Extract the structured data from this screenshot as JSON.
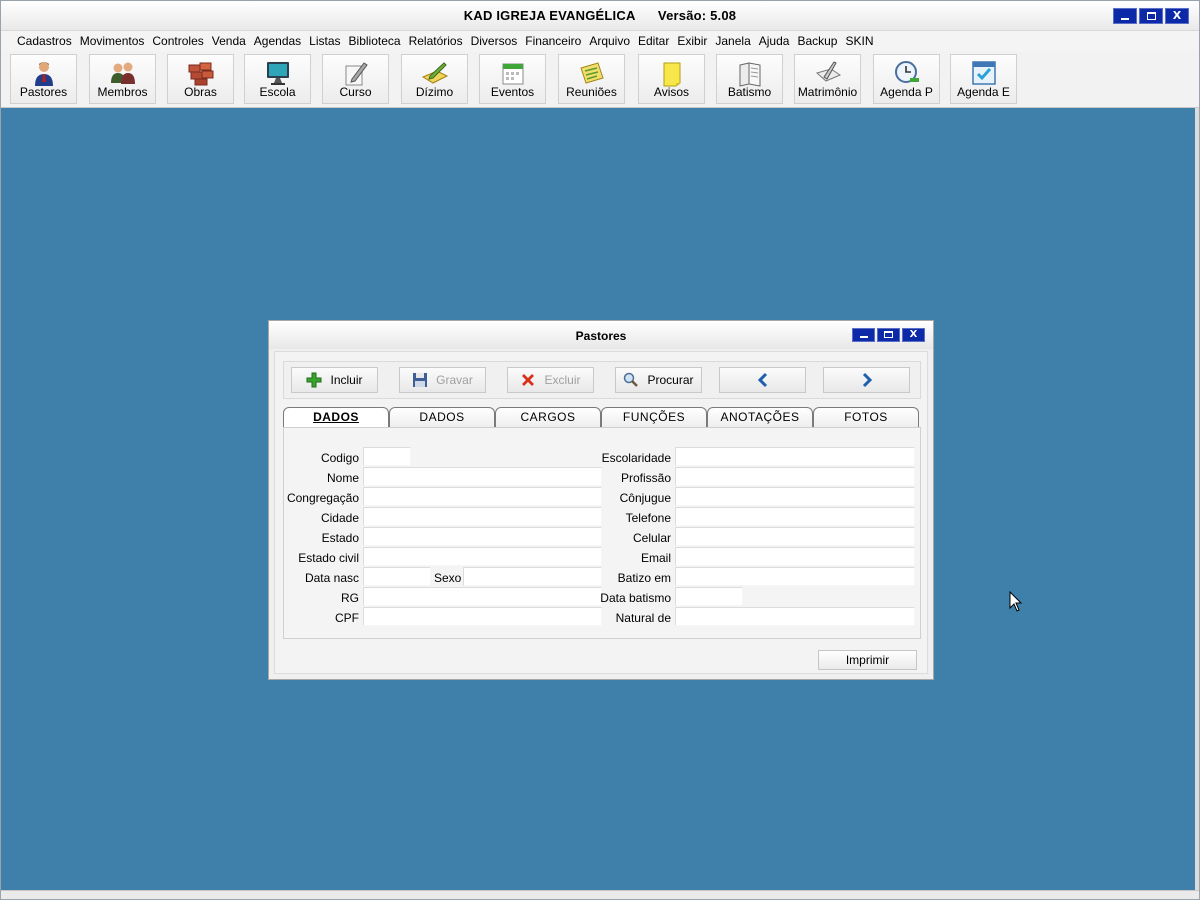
{
  "app": {
    "title": "KAD IGREJA EVANGÉLICA      Versão: 5.08",
    "window_buttons": {
      "close": "X"
    }
  },
  "menu": [
    "Cadastros",
    "Movimentos",
    "Controles",
    "Venda",
    "Agendas",
    "Listas",
    "Biblioteca",
    "Relatórios",
    "Diversos",
    "Financeiro",
    "Arquivo",
    "Editar",
    "Exibir",
    "Janela",
    "Ajuda",
    "Backup",
    "SKIN"
  ],
  "toolbar": [
    {
      "label": "Pastores",
      "icon": "pastor-icon"
    },
    {
      "label": "Membros",
      "icon": "members-icon"
    },
    {
      "label": "Obras",
      "icon": "bricks-icon"
    },
    {
      "label": "Escola",
      "icon": "monitor-icon"
    },
    {
      "label": "Curso",
      "icon": "pencil-paper-icon"
    },
    {
      "label": "Dízimo",
      "icon": "pen-note-icon"
    },
    {
      "label": "Eventos",
      "icon": "calendar-icon"
    },
    {
      "label": "Reuniões",
      "icon": "notes-icon"
    },
    {
      "label": "Avisos",
      "icon": "sticky-note-icon"
    },
    {
      "label": "Batismo",
      "icon": "book-icon"
    },
    {
      "label": "Matrimônio",
      "icon": "quill-book-icon"
    },
    {
      "label": "Agenda P",
      "icon": "clock-icon"
    },
    {
      "label": "Agenda E",
      "icon": "checked-calendar-icon"
    }
  ],
  "child_window": {
    "title": "Pastores",
    "window_buttons": {
      "close": "X"
    },
    "actions": {
      "incluir": "Incluir",
      "gravar": "Gravar",
      "excluir": "Excluir",
      "procurar": "Procurar"
    },
    "tabs": [
      "DADOS",
      "DADOS",
      "CARGOS",
      "FUNÇÕES",
      "ANOTAÇÕES",
      "FOTOS"
    ],
    "active_tab": 0,
    "left_fields": {
      "codigo": "Codigo",
      "nome": "Nome",
      "congregacao": "Congregação",
      "cidade": "Cidade",
      "estado": "Estado",
      "estado_civil": "Estado civil",
      "data_nasc": "Data nasc",
      "sexo": "Sexo",
      "rg": "RG",
      "cpf": "CPF"
    },
    "right_fields": {
      "escolaridade": "Escolaridade",
      "profissao": "Profissão",
      "conjugue": "Cônjugue",
      "telefone": "Telefone",
      "celular": "Celular",
      "email": "Email",
      "batizo_em": "Batizo em",
      "data_batismo": "Data batismo",
      "natural_de": "Natural de"
    },
    "print_label": "Imprimir"
  }
}
